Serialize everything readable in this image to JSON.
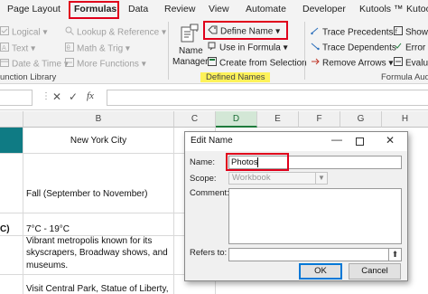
{
  "ribbon": {
    "tabs": [
      "Page Layout",
      "Formulas",
      "Data",
      "Review",
      "View",
      "Automate",
      "Developer",
      "Kutools ™",
      "Kutoo"
    ],
    "active_tab": "Formulas",
    "function_library": {
      "logical": "Logical",
      "text": "Text",
      "date_time": "Date & Time",
      "lookup_reference": "Lookup & Reference",
      "math_trig": "Math & Trig",
      "more_functions": "More Functions",
      "group_label": "unction Library"
    },
    "defined_names": {
      "name_manager_line1": "Name",
      "name_manager_line2": "Manager",
      "define_name": "Define Name",
      "use_in_formula": "Use in Formula",
      "create_from_selection": "Create from Selection",
      "group_label": "Defined Names"
    },
    "formula_auditing": {
      "trace_precedents": "Trace Precedents",
      "trace_dependents": "Trace Dependents",
      "remove_arrows": "Remove Arrows",
      "show": "Show",
      "error": "Error",
      "evaluate": "Evalu",
      "group_label": "Formula Audit"
    }
  },
  "formula_bar": {
    "fx": "fx"
  },
  "columns": [
    "B",
    "C",
    "D",
    "E",
    "F",
    "G",
    "H"
  ],
  "selected_column": "D",
  "cells": {
    "b_header": "New York City",
    "b_season": "Fall (September to November)",
    "a_temp_fragment": "C)",
    "b_temp": "7°C - 19°C",
    "b_desc_1": "Vibrant metropolis known for its",
    "b_desc_2": "skyscrapers, Broadway shows, and",
    "b_desc_3": "museums.",
    "b_visit": "Visit Central Park, Statue of Liberty,"
  },
  "dialog": {
    "title": "Edit Name",
    "name_label": "Name:",
    "name_value": "Photos",
    "scope_label": "Scope:",
    "scope_value": "Workbook",
    "comment_label": "Comment:",
    "refers_to_label": "Refers to:",
    "ok_label": "OK",
    "cancel_label": "Cancel"
  },
  "colors": {
    "highlight_red": "#e0001b",
    "highlight_yellow": "#fdf25a",
    "excel_green": "#1e7b3c",
    "teal_header": "#0f7b84"
  }
}
